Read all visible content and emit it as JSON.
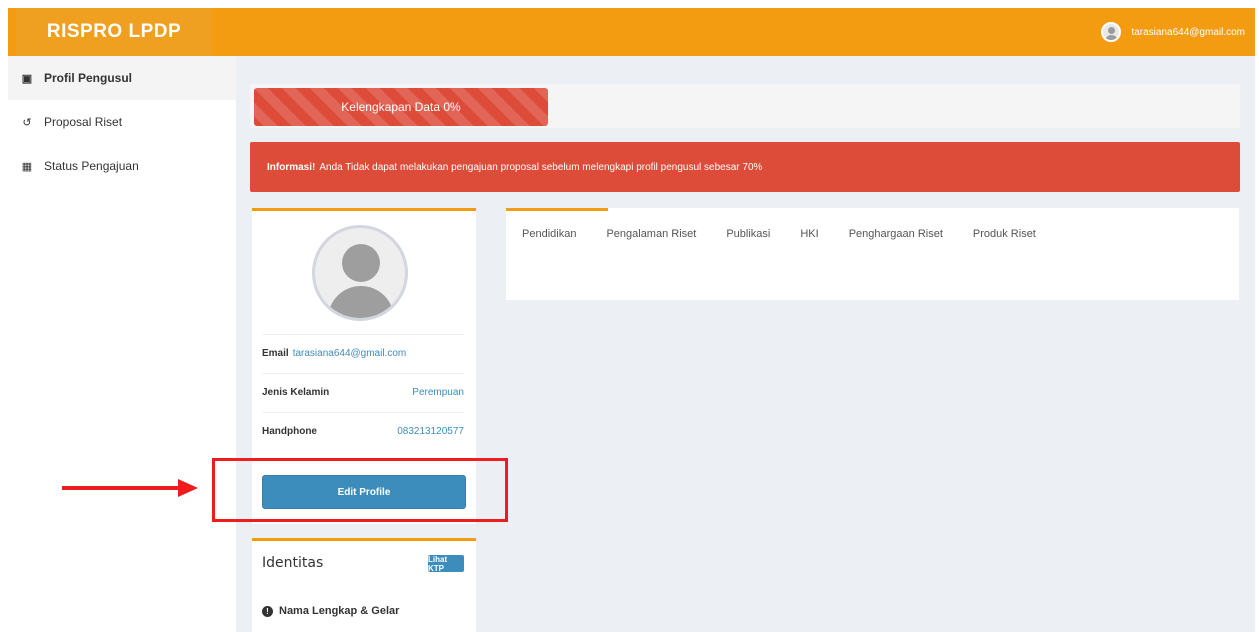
{
  "header": {
    "brand": "RISPRO LPDP",
    "user_email": "tarasiana644@gmail.com"
  },
  "sidebar": {
    "items": [
      {
        "label": "Profil Pengusul",
        "icon": "briefcase-icon"
      },
      {
        "label": "Proposal Riset",
        "icon": "history-icon"
      },
      {
        "label": "Status Pengajuan",
        "icon": "table-icon"
      }
    ]
  },
  "progress": {
    "label": "Kelengkapan Data 0%",
    "percent": 0
  },
  "alert": {
    "strong": "Informasi!",
    "text": "Anda Tidak dapat melakukan pengajuan proposal sebelum melengkapi profil pengusul sebesar 70%"
  },
  "profile": {
    "email_label": "Email",
    "email_value": "tarasiana644@gmail.com",
    "gender_label": "Jenis Kelamin",
    "gender_value": "Perempuan",
    "phone_label": "Handphone",
    "phone_value": "083213120577",
    "edit_button": "Edit Profile"
  },
  "identitas": {
    "title": "Identitas",
    "ktp_button": "Lihat KTP",
    "row_label": "Nama Lengkap & Gelar"
  },
  "tabs": [
    "Pendidikan",
    "Pengalaman Riset",
    "Publikasi",
    "HKI",
    "Penghargaan Riset",
    "Produk Riset"
  ],
  "colors": {
    "header": "#f39c12",
    "danger": "#dd4b39",
    "primary": "#3c8dbc",
    "highlight": "#ee1c1c"
  }
}
